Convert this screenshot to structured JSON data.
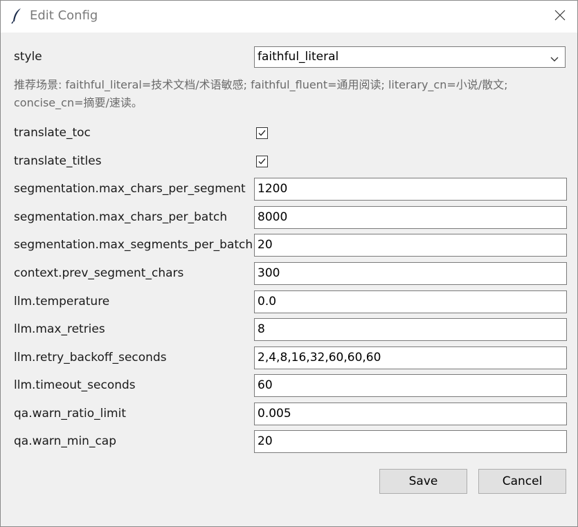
{
  "window": {
    "title": "Edit Config"
  },
  "style": {
    "label": "style",
    "value": "faithful_literal",
    "hint": "推荐场景: faithful_literal=技术文档/术语敏感; faithful_fluent=通用阅读; literary_cn=小说/散文; concise_cn=摘要/速读。"
  },
  "checkboxes": [
    {
      "label": "translate_toc",
      "checked": true
    },
    {
      "label": "translate_titles",
      "checked": true
    }
  ],
  "fields": [
    {
      "label": "segmentation.max_chars_per_segment",
      "value": "1200"
    },
    {
      "label": "segmentation.max_chars_per_batch",
      "value": "8000"
    },
    {
      "label": "segmentation.max_segments_per_batch",
      "value": "20"
    },
    {
      "label": "context.prev_segment_chars",
      "value": "300"
    },
    {
      "label": "llm.temperature",
      "value": "0.0"
    },
    {
      "label": "llm.max_retries",
      "value": "8"
    },
    {
      "label": "llm.retry_backoff_seconds",
      "value": "2,4,8,16,32,60,60,60"
    },
    {
      "label": "llm.timeout_seconds",
      "value": "60"
    },
    {
      "label": "qa.warn_ratio_limit",
      "value": "0.005"
    },
    {
      "label": "qa.warn_min_cap",
      "value": "20"
    }
  ],
  "buttons": {
    "save": "Save",
    "cancel": "Cancel"
  },
  "icons": {
    "app": "feather-icon",
    "close": "close-icon",
    "dropdown": "chevron-down-icon",
    "check": "checkmark-icon"
  }
}
